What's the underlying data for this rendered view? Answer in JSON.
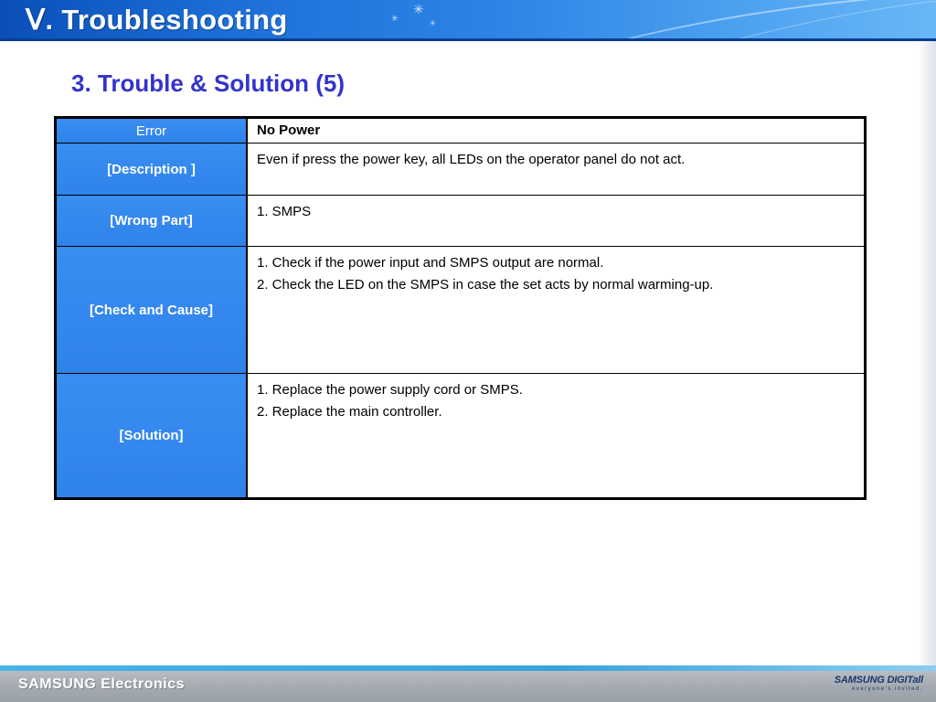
{
  "header": {
    "title": "Ⅴ. Troubleshooting"
  },
  "section": {
    "title": "3. Trouble & Solution (5)"
  },
  "table": {
    "rows": [
      {
        "label": "Error",
        "value_lines": [
          "No Power"
        ]
      },
      {
        "label": "[Description ]",
        "value_lines": [
          "Even if press the power key, all LEDs on the operator panel do not act."
        ]
      },
      {
        "label": "[Wrong Part]",
        "value_lines": [
          "1. SMPS"
        ]
      },
      {
        "label": "[Check and Cause]",
        "value_lines": [
          "1. Check if the power input and SMPS output are normal.",
          "2. Check the LED on the SMPS in case the set acts by normal warming-up."
        ]
      },
      {
        "label": "[Solution]",
        "value_lines": [
          "1. Replace the power supply cord or SMPS.",
          "2. Replace the main controller."
        ]
      }
    ]
  },
  "footer": {
    "left": "SAMSUNG Electronics",
    "right_main": "SAMSUNG DIGITall",
    "right_sub": "everyone's invited."
  },
  "colors": {
    "header_blue": "#1d6fd8",
    "section_title": "#3333cc",
    "label_cell": "#2f82ea",
    "footer_gray": "#a6abb2"
  },
  "icons": [
    "star-icon"
  ]
}
